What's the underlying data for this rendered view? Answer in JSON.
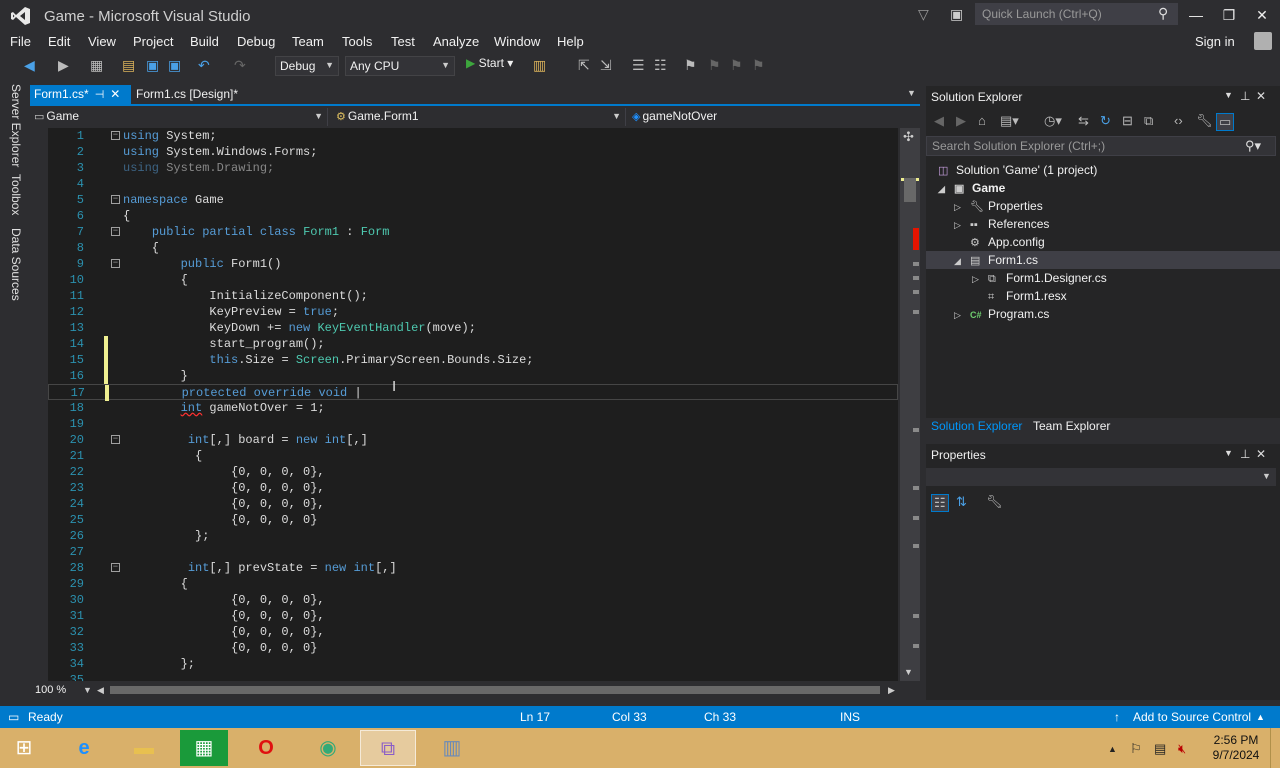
{
  "window": {
    "title": "Game - Microsoft Visual Studio",
    "quick_launch_placeholder": "Quick Launch (Ctrl+Q)"
  },
  "menu": [
    "File",
    "Edit",
    "View",
    "Project",
    "Build",
    "Debug",
    "Team",
    "Tools",
    "Test",
    "Analyze",
    "Window",
    "Help"
  ],
  "account": {
    "sign_in": "Sign in"
  },
  "toolbar": {
    "configuration": "Debug",
    "platform": "Any CPU",
    "start_label": "Start"
  },
  "side_tabs": [
    "Server Explorer",
    "Toolbox",
    "Data Sources"
  ],
  "doc_tabs": [
    {
      "label": "Form1.cs*",
      "active": true
    },
    {
      "label": "Form1.cs [Design]*",
      "active": false
    }
  ],
  "nav": {
    "project": "Game",
    "type": "Game.Form1",
    "member": "gameNotOver"
  },
  "editor": {
    "zoom": "100 %",
    "lines": [
      {
        "n": "1",
        "t": "using System;"
      },
      {
        "n": "2",
        "t": "using System.Windows.Forms;"
      },
      {
        "n": "3",
        "t": "using System.Drawing;"
      },
      {
        "n": "4",
        "t": ""
      },
      {
        "n": "5",
        "t": "namespace Game"
      },
      {
        "n": "6",
        "t": "{"
      },
      {
        "n": "7",
        "t": "    public partial class Form1 : Form"
      },
      {
        "n": "8",
        "t": "    {"
      },
      {
        "n": "9",
        "t": "        public Form1()"
      },
      {
        "n": "10",
        "t": "        {"
      },
      {
        "n": "11",
        "t": "            InitializeComponent();"
      },
      {
        "n": "12",
        "t": "            KeyPreview = true;"
      },
      {
        "n": "13",
        "t": "            KeyDown += new KeyEventHandler(move);"
      },
      {
        "n": "14",
        "t": "            start_program();"
      },
      {
        "n": "15",
        "t": "            this.Size = Screen.PrimaryScreen.Bounds.Size;"
      },
      {
        "n": "16",
        "t": "        }"
      },
      {
        "n": "17",
        "t": "        protected override void "
      },
      {
        "n": "18",
        "t": "        int gameNotOver = 1;"
      },
      {
        "n": "19",
        "t": ""
      },
      {
        "n": "20",
        "t": "         int[,] board = new int[,]"
      },
      {
        "n": "21",
        "t": "          {"
      },
      {
        "n": "22",
        "t": "               {0, 0, 0, 0},"
      },
      {
        "n": "23",
        "t": "               {0, 0, 0, 0},"
      },
      {
        "n": "24",
        "t": "               {0, 0, 0, 0},"
      },
      {
        "n": "25",
        "t": "               {0, 0, 0, 0}"
      },
      {
        "n": "26",
        "t": "          };"
      },
      {
        "n": "27",
        "t": ""
      },
      {
        "n": "28",
        "t": "         int[,] prevState = new int[,]"
      },
      {
        "n": "29",
        "t": "        {"
      },
      {
        "n": "30",
        "t": "               {0, 0, 0, 0},"
      },
      {
        "n": "31",
        "t": "               {0, 0, 0, 0},"
      },
      {
        "n": "32",
        "t": "               {0, 0, 0, 0},"
      },
      {
        "n": "33",
        "t": "               {0, 0, 0, 0}"
      },
      {
        "n": "34",
        "t": "        };"
      },
      {
        "n": "35",
        "t": ""
      }
    ]
  },
  "solution_explorer": {
    "title": "Solution Explorer",
    "search_placeholder": "Search Solution Explorer (Ctrl+;)",
    "tree": [
      {
        "label": "Solution 'Game' (1 project)",
        "icon": "solution-icon"
      },
      {
        "label": "Game",
        "icon": "project-icon"
      },
      {
        "label": "Properties",
        "icon": "wrench-icon"
      },
      {
        "label": "References",
        "icon": "references-icon"
      },
      {
        "label": "App.config",
        "icon": "config-icon"
      },
      {
        "label": "Form1.cs",
        "icon": "form-icon"
      },
      {
        "label": "Form1.Designer.cs",
        "icon": "designer-file-icon"
      },
      {
        "label": "Form1.resx",
        "icon": "resx-icon"
      },
      {
        "label": "Program.cs",
        "icon": "csharp-file-icon"
      }
    ],
    "tabs": [
      "Solution Explorer",
      "Team Explorer"
    ]
  },
  "properties": {
    "title": "Properties"
  },
  "status": {
    "ready": "Ready",
    "line": "Ln 17",
    "col": "Col 33",
    "ch": "Ch 33",
    "mode": "INS",
    "source_control": "Add to Source Control"
  },
  "taskbar": {
    "time": "2:56 PM",
    "date": "9/7/2024"
  },
  "colors": {
    "accent": "#007acc",
    "editor_bg": "#1e1e1e",
    "keyword": "#569cd6",
    "type": "#4ec9b0",
    "line_number": "#2b91af",
    "taskbar": "#d9b06a"
  }
}
